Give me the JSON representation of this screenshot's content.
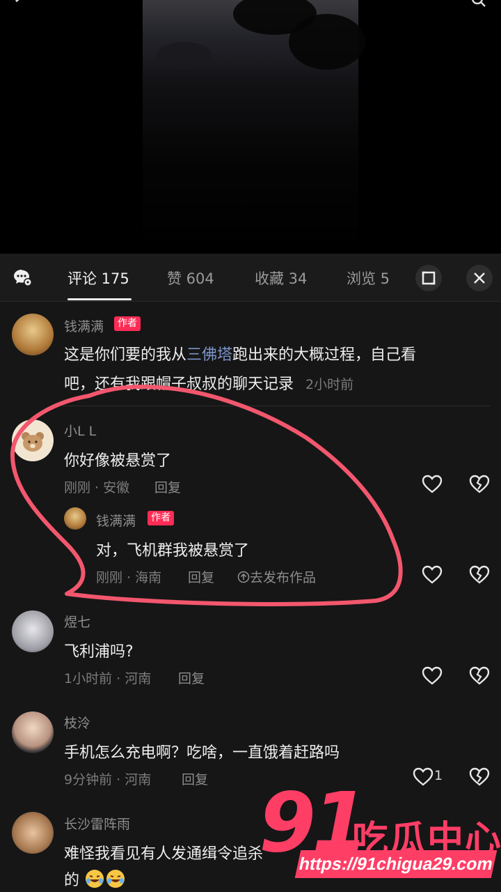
{
  "tabs": [
    {
      "label": "评论 175",
      "active": true
    },
    {
      "label": "赞 604",
      "active": false
    },
    {
      "label": "收藏 34",
      "active": false
    },
    {
      "label": "浏览 5",
      "active": false
    }
  ],
  "comments": [
    {
      "user": "钱满满",
      "badge": "作者",
      "text_prefix": "这是你们要的我从",
      "text_link": "三佛塔",
      "text_suffix": "跑出来的大概过程，自己看",
      "text_line2": "吧，还有我跟帽子叔叔的聊天记录",
      "time": "2小时前"
    },
    {
      "user": "小L L",
      "text": "你好像被悬赏了",
      "meta": "刚刚 · 安徽",
      "reply_label": "回复"
    },
    {
      "user": "钱满满",
      "badge": "作者",
      "text": "对，飞机群我被悬赏了",
      "meta": "刚刚 · 海南",
      "reply_label": "回复",
      "publish_label": "去发布作品"
    },
    {
      "user": "煜七",
      "text": "飞利浦吗?",
      "meta": "1小时前 · 河南",
      "reply_label": "回复"
    },
    {
      "user": "枝泠",
      "text": "手机怎么充电啊？吃啥，一直饿着赶路吗",
      "meta": "9分钟前 · 河南",
      "reply_label": "回复",
      "likes": "1"
    },
    {
      "user": "长沙雷阵雨",
      "text": "难怪我看见有人发通缉令追杀",
      "text_line2": "的"
    }
  ],
  "watermark": {
    "number": "91",
    "name": "吃瓜中心",
    "url": "https://91chigua29.com"
  },
  "colors": {
    "badge": "#fe2c55",
    "link": "#7b94c9",
    "annotation": "#f2576e",
    "watermark": "#ff3e66"
  }
}
